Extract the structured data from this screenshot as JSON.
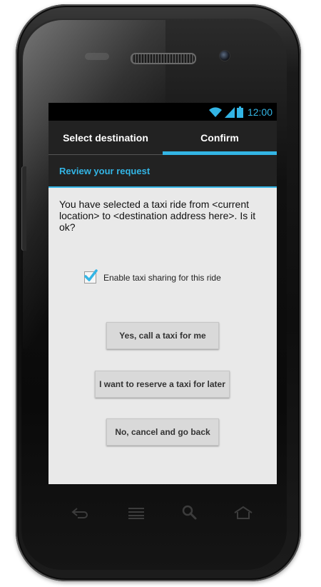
{
  "status_bar": {
    "time": "12:00",
    "icons": [
      "wifi-icon",
      "signal-icon",
      "battery-icon"
    ],
    "accent_color": "#33b5e5"
  },
  "tabs": [
    {
      "label": "Select destination",
      "selected": false
    },
    {
      "label": "Confirm",
      "selected": true
    }
  ],
  "section": {
    "title": "Review your request"
  },
  "message": "You have selected a taxi ride from <current location> to <destination address here>. Is it ok?",
  "taxi_sharing": {
    "label": "Enable taxi sharing for this ride",
    "checked": true
  },
  "buttons": {
    "call_now": "Yes, call a taxi for me",
    "reserve_later": "I want to reserve a taxi for later",
    "cancel": "No, cancel and go back"
  },
  "nav_keys": [
    "back-icon",
    "home-icon",
    "search-icon",
    "menu-icon"
  ],
  "colors": {
    "accent": "#33b5e5",
    "action_bar": "#222222",
    "content_background": "#e9e9e9"
  }
}
